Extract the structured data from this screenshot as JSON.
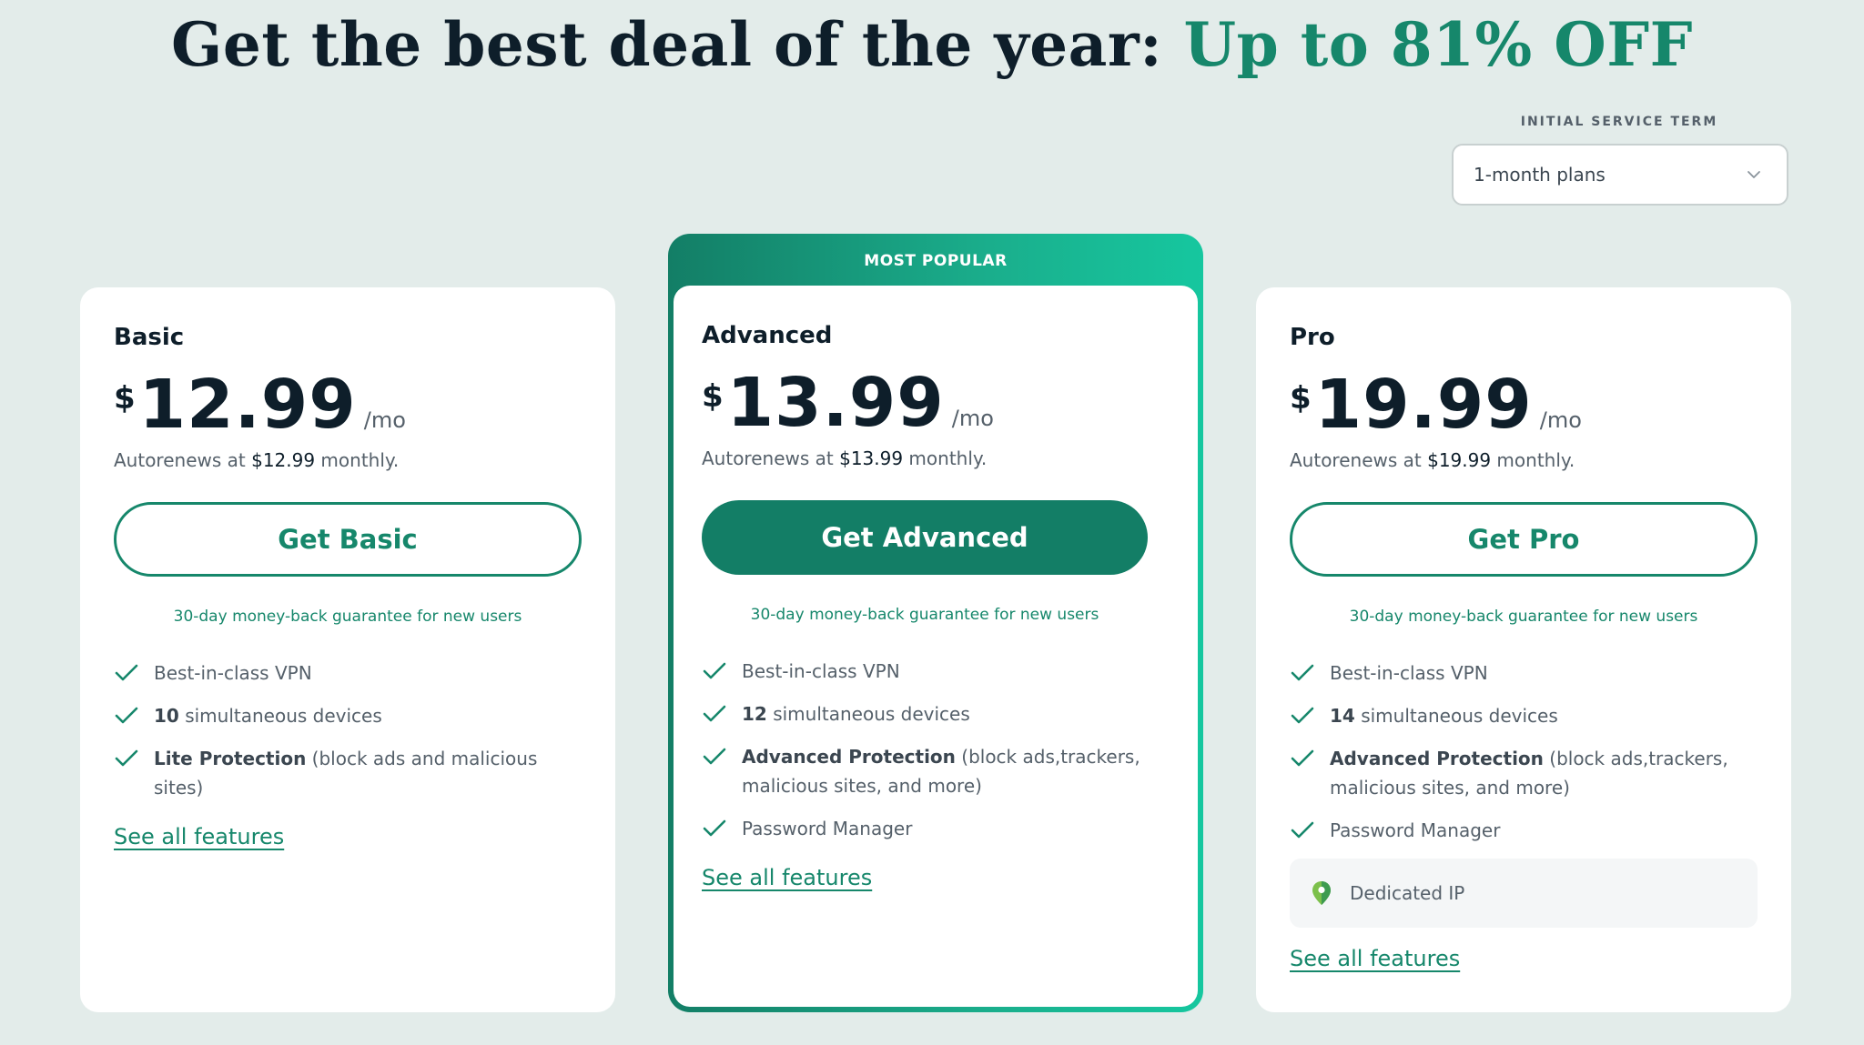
{
  "headline": {
    "main": "Get the best deal of the year: ",
    "accent": "Up to 81% OFF"
  },
  "term": {
    "label": "INITIAL SERVICE TERM",
    "selected": "1-month plans",
    "icon": "chevron-down-icon"
  },
  "colors": {
    "accent": "#16876b",
    "cta_solid": "#137e66",
    "text_dark": "#0e1e2a",
    "background": "#e3ecea"
  },
  "plans": [
    {
      "name": "Basic",
      "currency": "$",
      "price": "12.99",
      "per": "/mo",
      "renew_prefix": "Autorenews at ",
      "renew_price": "$12.99",
      "renew_suffix": " monthly.",
      "cta": "Get Basic",
      "guarantee": "30-day money-back guarantee for new users",
      "features": [
        {
          "bold": "",
          "text": "Best-in-class VPN"
        },
        {
          "bold": "10",
          "text": " simultaneous devices"
        },
        {
          "bold": "Lite Protection",
          "text": " (block ads and malicious sites)"
        }
      ],
      "see_all": "See all features"
    },
    {
      "badge": "MOST POPULAR",
      "name": "Advanced",
      "currency": "$",
      "price": "13.99",
      "per": "/mo",
      "renew_prefix": "Autorenews at ",
      "renew_price": "$13.99",
      "renew_suffix": " monthly.",
      "cta": "Get Advanced",
      "guarantee": "30-day money-back guarantee for new users",
      "features": [
        {
          "bold": "",
          "text": "Best-in-class VPN"
        },
        {
          "bold": "12",
          "text": " simultaneous devices"
        },
        {
          "bold": "Advanced Protection",
          "text": " (block ads,trackers, malicious sites, and more)"
        },
        {
          "bold": "",
          "text": "Password Manager"
        }
      ],
      "see_all": "See all features"
    },
    {
      "name": "Pro",
      "currency": "$",
      "price": "19.99",
      "per": "/mo",
      "renew_prefix": "Autorenews at ",
      "renew_price": "$19.99",
      "renew_suffix": " monthly.",
      "cta": "Get Pro",
      "guarantee": "30-day money-back guarantee for new users",
      "features": [
        {
          "bold": "",
          "text": "Best-in-class VPN"
        },
        {
          "bold": "14",
          "text": " simultaneous devices"
        },
        {
          "bold": "Advanced Protection",
          "text": " (block ads,trackers, malicious sites, and more)"
        },
        {
          "bold": "",
          "text": "Password Manager"
        }
      ],
      "extra": {
        "icon": "location-pin-icon",
        "text": "Dedicated IP"
      },
      "see_all": "See all features"
    }
  ]
}
